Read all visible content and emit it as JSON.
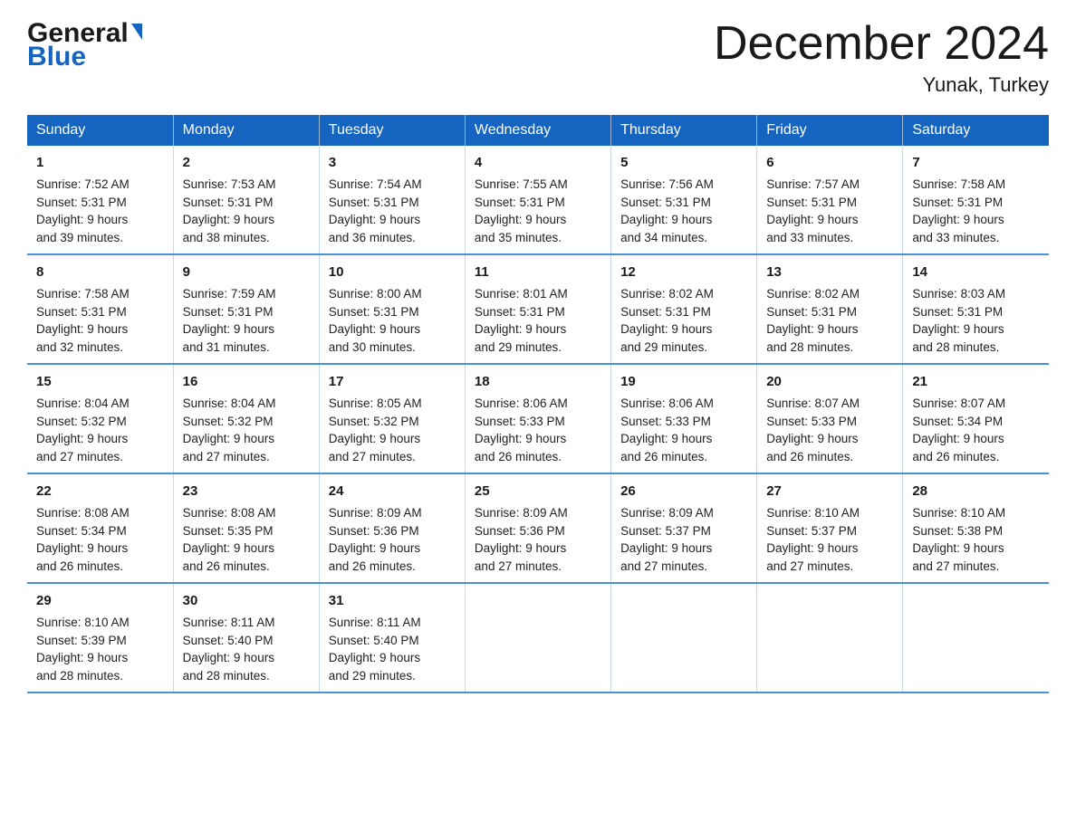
{
  "header": {
    "logo_general": "General",
    "logo_blue": "Blue",
    "title": "December 2024",
    "subtitle": "Yunak, Turkey"
  },
  "days_of_week": [
    "Sunday",
    "Monday",
    "Tuesday",
    "Wednesday",
    "Thursday",
    "Friday",
    "Saturday"
  ],
  "weeks": [
    [
      {
        "num": "1",
        "sunrise": "7:52 AM",
        "sunset": "5:31 PM",
        "daylight": "9 hours and 39 minutes."
      },
      {
        "num": "2",
        "sunrise": "7:53 AM",
        "sunset": "5:31 PM",
        "daylight": "9 hours and 38 minutes."
      },
      {
        "num": "3",
        "sunrise": "7:54 AM",
        "sunset": "5:31 PM",
        "daylight": "9 hours and 36 minutes."
      },
      {
        "num": "4",
        "sunrise": "7:55 AM",
        "sunset": "5:31 PM",
        "daylight": "9 hours and 35 minutes."
      },
      {
        "num": "5",
        "sunrise": "7:56 AM",
        "sunset": "5:31 PM",
        "daylight": "9 hours and 34 minutes."
      },
      {
        "num": "6",
        "sunrise": "7:57 AM",
        "sunset": "5:31 PM",
        "daylight": "9 hours and 33 minutes."
      },
      {
        "num": "7",
        "sunrise": "7:58 AM",
        "sunset": "5:31 PM",
        "daylight": "9 hours and 33 minutes."
      }
    ],
    [
      {
        "num": "8",
        "sunrise": "7:58 AM",
        "sunset": "5:31 PM",
        "daylight": "9 hours and 32 minutes."
      },
      {
        "num": "9",
        "sunrise": "7:59 AM",
        "sunset": "5:31 PM",
        "daylight": "9 hours and 31 minutes."
      },
      {
        "num": "10",
        "sunrise": "8:00 AM",
        "sunset": "5:31 PM",
        "daylight": "9 hours and 30 minutes."
      },
      {
        "num": "11",
        "sunrise": "8:01 AM",
        "sunset": "5:31 PM",
        "daylight": "9 hours and 29 minutes."
      },
      {
        "num": "12",
        "sunrise": "8:02 AM",
        "sunset": "5:31 PM",
        "daylight": "9 hours and 29 minutes."
      },
      {
        "num": "13",
        "sunrise": "8:02 AM",
        "sunset": "5:31 PM",
        "daylight": "9 hours and 28 minutes."
      },
      {
        "num": "14",
        "sunrise": "8:03 AM",
        "sunset": "5:31 PM",
        "daylight": "9 hours and 28 minutes."
      }
    ],
    [
      {
        "num": "15",
        "sunrise": "8:04 AM",
        "sunset": "5:32 PM",
        "daylight": "9 hours and 27 minutes."
      },
      {
        "num": "16",
        "sunrise": "8:04 AM",
        "sunset": "5:32 PM",
        "daylight": "9 hours and 27 minutes."
      },
      {
        "num": "17",
        "sunrise": "8:05 AM",
        "sunset": "5:32 PM",
        "daylight": "9 hours and 27 minutes."
      },
      {
        "num": "18",
        "sunrise": "8:06 AM",
        "sunset": "5:33 PM",
        "daylight": "9 hours and 26 minutes."
      },
      {
        "num": "19",
        "sunrise": "8:06 AM",
        "sunset": "5:33 PM",
        "daylight": "9 hours and 26 minutes."
      },
      {
        "num": "20",
        "sunrise": "8:07 AM",
        "sunset": "5:33 PM",
        "daylight": "9 hours and 26 minutes."
      },
      {
        "num": "21",
        "sunrise": "8:07 AM",
        "sunset": "5:34 PM",
        "daylight": "9 hours and 26 minutes."
      }
    ],
    [
      {
        "num": "22",
        "sunrise": "8:08 AM",
        "sunset": "5:34 PM",
        "daylight": "9 hours and 26 minutes."
      },
      {
        "num": "23",
        "sunrise": "8:08 AM",
        "sunset": "5:35 PM",
        "daylight": "9 hours and 26 minutes."
      },
      {
        "num": "24",
        "sunrise": "8:09 AM",
        "sunset": "5:36 PM",
        "daylight": "9 hours and 26 minutes."
      },
      {
        "num": "25",
        "sunrise": "8:09 AM",
        "sunset": "5:36 PM",
        "daylight": "9 hours and 27 minutes."
      },
      {
        "num": "26",
        "sunrise": "8:09 AM",
        "sunset": "5:37 PM",
        "daylight": "9 hours and 27 minutes."
      },
      {
        "num": "27",
        "sunrise": "8:10 AM",
        "sunset": "5:37 PM",
        "daylight": "9 hours and 27 minutes."
      },
      {
        "num": "28",
        "sunrise": "8:10 AM",
        "sunset": "5:38 PM",
        "daylight": "9 hours and 27 minutes."
      }
    ],
    [
      {
        "num": "29",
        "sunrise": "8:10 AM",
        "sunset": "5:39 PM",
        "daylight": "9 hours and 28 minutes."
      },
      {
        "num": "30",
        "sunrise": "8:11 AM",
        "sunset": "5:40 PM",
        "daylight": "9 hours and 28 minutes."
      },
      {
        "num": "31",
        "sunrise": "8:11 AM",
        "sunset": "5:40 PM",
        "daylight": "9 hours and 29 minutes."
      },
      null,
      null,
      null,
      null
    ]
  ]
}
